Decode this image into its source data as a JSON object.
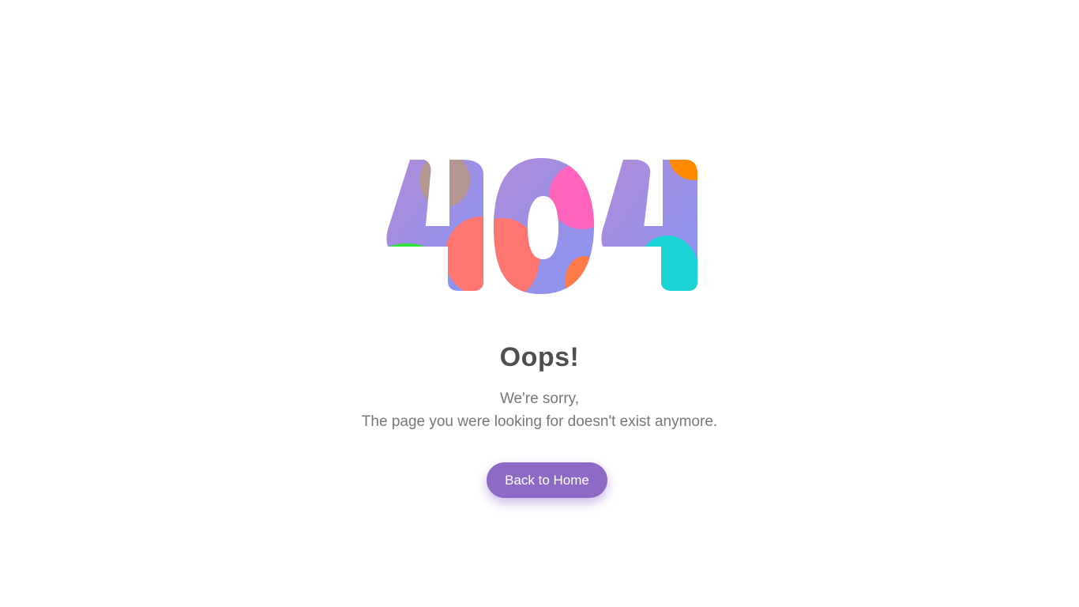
{
  "art": {
    "label": "404",
    "icon": "404-graphic"
  },
  "content": {
    "title": "Oops!",
    "message_line1": "We're sorry,",
    "message_line2": "The page you were looking for doesn't exist anymore."
  },
  "button": {
    "label": "Back to Home",
    "color": "#8e6ac6"
  },
  "colors": {
    "gradient_start": "#b38ad6",
    "gradient_end": "#8495f5",
    "coral": "#ff7670",
    "pink": "#ff64bc",
    "teal": "#19d3d4",
    "orange": "#ff8a00",
    "green": "#2fe03a",
    "taupe": "#b5968a",
    "text_dark": "#4f4f4f",
    "text_gray": "#777777"
  }
}
